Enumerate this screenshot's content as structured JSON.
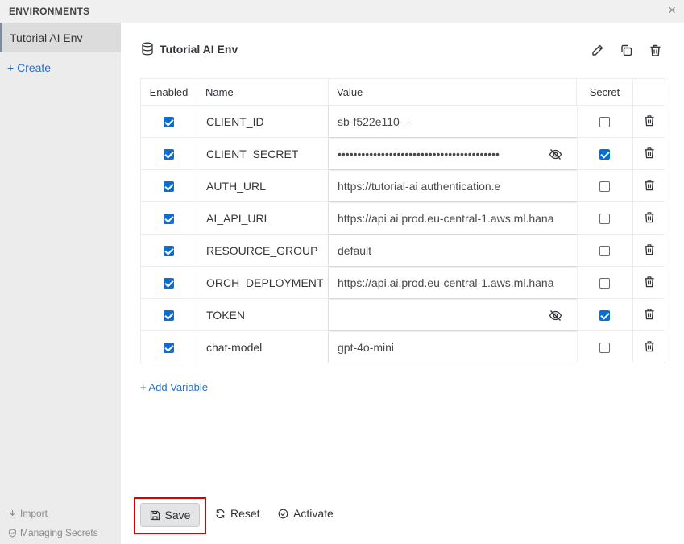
{
  "window": {
    "title": "ENVIRONMENTS",
    "close_glyph": "×"
  },
  "sidebar": {
    "environments": [
      {
        "label": "Tutorial AI Env",
        "selected": true
      }
    ],
    "create_label": "+ Create",
    "import_label": "Import",
    "managing_secrets_label": "Managing Secrets"
  },
  "environment": {
    "name": "Tutorial AI Env",
    "actions": [
      "edit-icon",
      "copy-icon",
      "trash-icon"
    ]
  },
  "table": {
    "headers": {
      "enabled": "Enabled",
      "name": "Name",
      "value": "Value",
      "secret": "Secret"
    },
    "rows": [
      {
        "enabled": true,
        "name": "CLIENT_ID",
        "value": "sb-f522e110-                                          ·",
        "secret": false,
        "masked": false
      },
      {
        "enabled": true,
        "name": "CLIENT_SECRET",
        "value": "•••••••••••••••••••••••••••••••••••••••••",
        "secret": true,
        "masked": true
      },
      {
        "enabled": true,
        "name": "AUTH_URL",
        "value": "https://tutorial-ai                authentication.e",
        "secret": false,
        "masked": false
      },
      {
        "enabled": true,
        "name": "AI_API_URL",
        "value": "https://api.ai.prod.eu-central-1.aws.ml.hana",
        "secret": false,
        "masked": false
      },
      {
        "enabled": true,
        "name": "RESOURCE_GROUP",
        "value": "default",
        "secret": false,
        "masked": false
      },
      {
        "enabled": true,
        "name": "ORCH_DEPLOYMENT",
        "value": "https://api.ai.prod.eu-central-1.aws.ml.hana",
        "secret": false,
        "masked": false
      },
      {
        "enabled": true,
        "name": "TOKEN",
        "value": "",
        "secret": true,
        "masked": true
      },
      {
        "enabled": true,
        "name": "chat-model",
        "value": "gpt-4o-mini",
        "secret": false,
        "masked": false
      }
    ]
  },
  "add_variable_label": "+ Add Variable",
  "footer": {
    "save_label": "Save",
    "reset_label": "Reset",
    "activate_label": "Activate"
  },
  "colors": {
    "accent": "#0a6ed1",
    "link": "#2b6fc2",
    "highlight": "#d60000"
  }
}
